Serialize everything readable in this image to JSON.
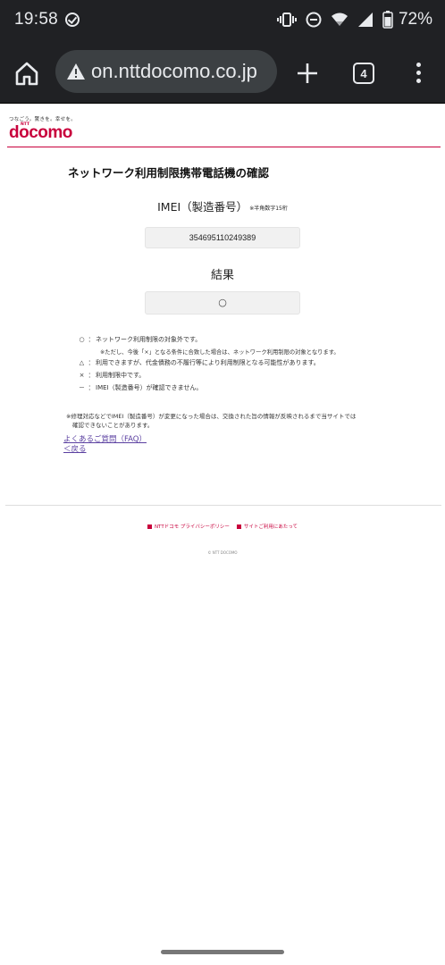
{
  "status_bar": {
    "time": "19:58",
    "battery": "72%"
  },
  "browser": {
    "url": "on.nttdocomo.co.jp",
    "tab_count": "4"
  },
  "header": {
    "tagline": "つなごう。驚きを。幸せを。",
    "logo_small": "NTT",
    "logo": "docomo"
  },
  "main": {
    "title": "ネットワーク利用制限携帯電話機の確認",
    "imei_label": "IMEI（製造番号）",
    "imei_note": "※半角数字15桁",
    "imei_value": "354695110249389",
    "result_label": "結果",
    "result_value": "○"
  },
  "legend": {
    "items": [
      {
        "symbol": "○",
        "colon": "：",
        "text": "ネットワーク利用制限の対象外です。"
      },
      {
        "sub": "※ただし、今後「×」となる条件に合致した場合は、ネットワーク利用制限の対象となります。"
      },
      {
        "symbol": "△",
        "colon": "：",
        "text": "利用できますが、代金債務の不履行等により利用制限となる可能性があります。"
      },
      {
        "symbol": "×",
        "colon": "：",
        "text": "利用制限中です。"
      },
      {
        "symbol": "－",
        "colon": "：",
        "text": "IMEI（製造番号）が確認できません。"
      }
    ]
  },
  "notes": {
    "line1": "※修理対応などでIMEI（製造番号）が変更になった場合は、交換された旨の情報が反映されるまで当サイトでは",
    "line2": "確認できないことがあります。"
  },
  "links": {
    "faq": "よくあるご質問（FAQ）",
    "back": "＜戻る"
  },
  "footer": {
    "privacy": "NTTドコモ プライバシーポリシー",
    "usage": "サイトご利用にあたって",
    "copyright": "© NTT DOCOMO"
  },
  "colors": {
    "brand": "#c8003c",
    "toolbar": "#202124",
    "link": "#5a3fa0"
  }
}
